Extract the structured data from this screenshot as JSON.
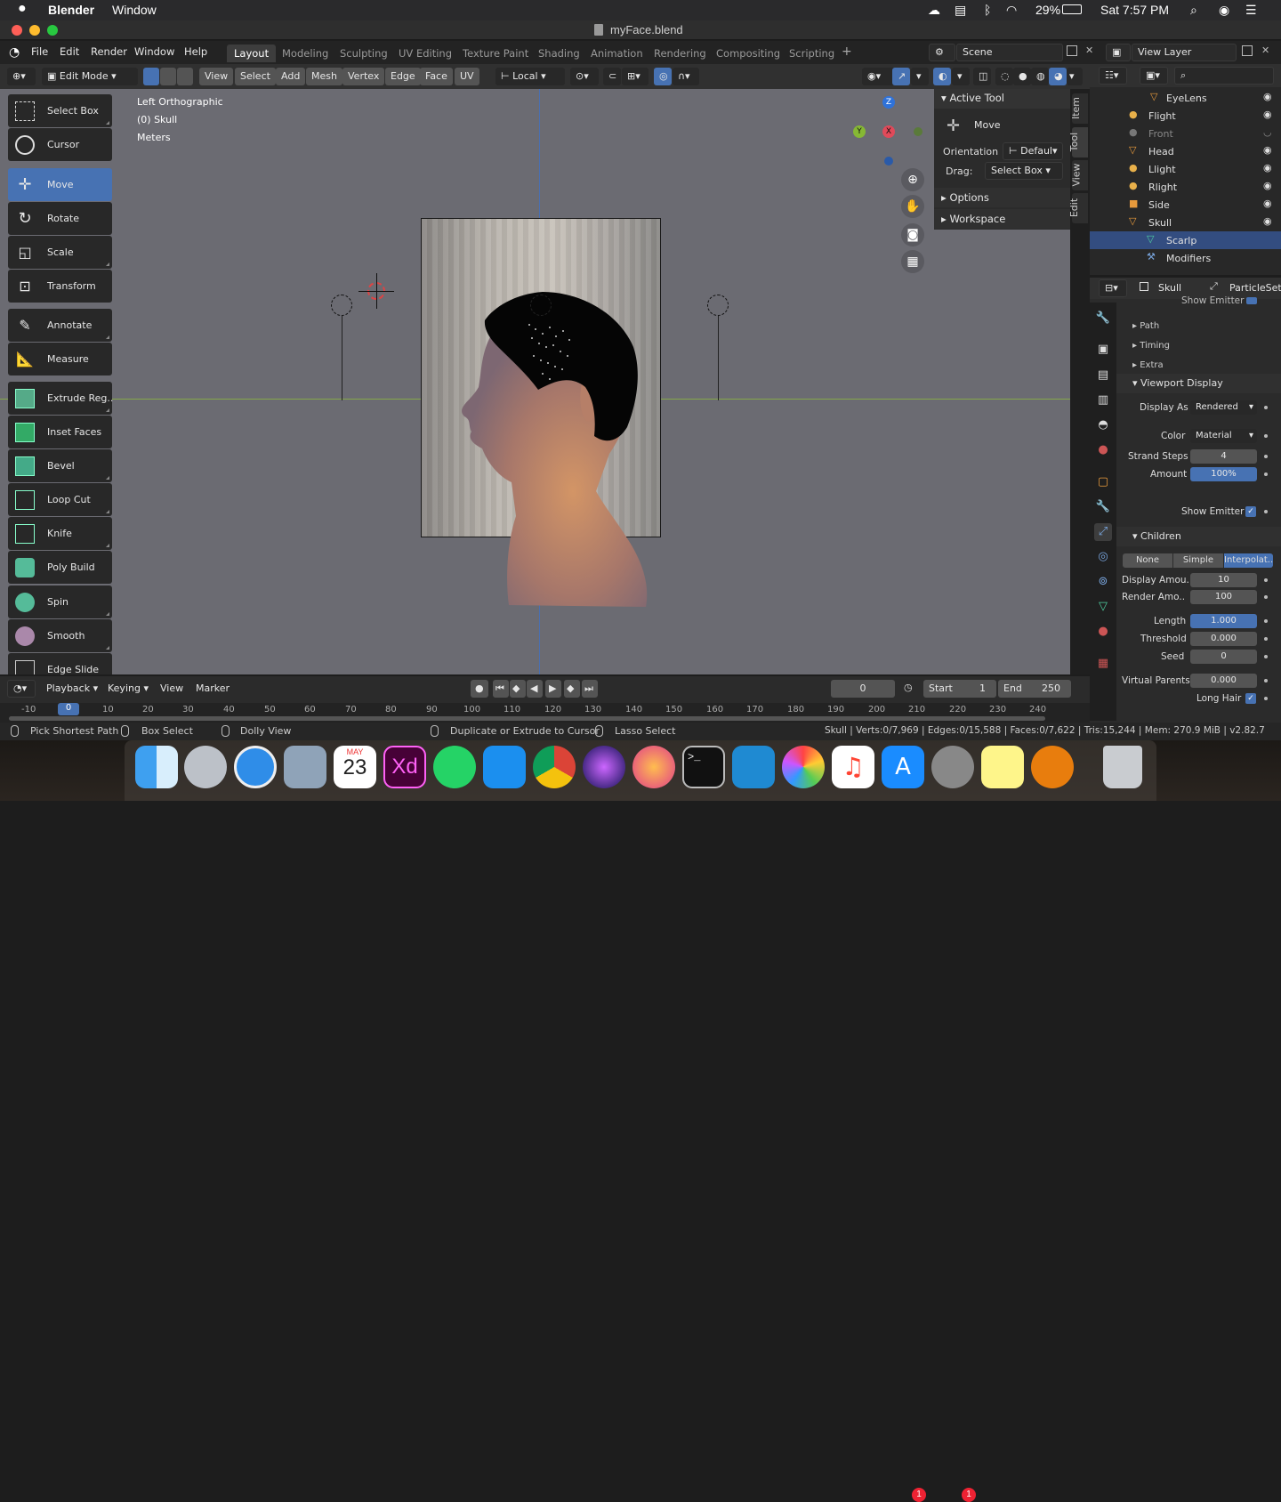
{
  "menubar": {
    "app_name": "Blender",
    "menu_window": "Window",
    "battery": "29%",
    "clock": "Sat 7:57 PM"
  },
  "title": "myFace.blend",
  "topbar": {
    "menus": [
      "File",
      "Edit",
      "Render",
      "Window",
      "Help"
    ],
    "workspaces": [
      "Layout",
      "Modeling",
      "Sculpting",
      "UV Editing",
      "Texture Paint",
      "Shading",
      "Animation",
      "Rendering",
      "Compositing",
      "Scripting"
    ],
    "active_workspace": "Layout",
    "scene": "Scene",
    "view_layer": "View Layer"
  },
  "header": {
    "mode": "Edit Mode",
    "menus": [
      "View",
      "Select",
      "Add",
      "Mesh",
      "Vertex",
      "Edge",
      "Face",
      "UV"
    ],
    "orientation": "Local"
  },
  "viewport": {
    "view_name": "Left Orthographic",
    "object_info": "(0) Skull",
    "units": "Meters",
    "gizmo": {
      "z": "Z",
      "y": "Y",
      "x": "X"
    }
  },
  "toolbar": {
    "tools": [
      {
        "label": "Select Box",
        "icon": "select-box-icon"
      },
      {
        "label": "Cursor",
        "icon": "cursor-icon"
      },
      {
        "label": "Move",
        "icon": "move-icon",
        "active": true
      },
      {
        "label": "Rotate",
        "icon": "rotate-icon"
      },
      {
        "label": "Scale",
        "icon": "scale-icon"
      },
      {
        "label": "Transform",
        "icon": "transform-icon"
      },
      {
        "label": "Annotate",
        "icon": "annotate-icon"
      },
      {
        "label": "Measure",
        "icon": "measure-icon"
      },
      {
        "label": "Extrude Reg..",
        "icon": "extrude-icon"
      },
      {
        "label": "Inset Faces",
        "icon": "inset-icon"
      },
      {
        "label": "Bevel",
        "icon": "bevel-icon"
      },
      {
        "label": "Loop Cut",
        "icon": "loop-cut-icon"
      },
      {
        "label": "Knife",
        "icon": "knife-icon"
      },
      {
        "label": "Poly Build",
        "icon": "poly-build-icon"
      },
      {
        "label": "Spin",
        "icon": "spin-icon"
      },
      {
        "label": "Smooth",
        "icon": "smooth-icon"
      },
      {
        "label": "Edge Slide",
        "icon": "edge-slide-icon"
      }
    ]
  },
  "npanel": {
    "active_tool_title": "Active Tool",
    "tool_name": "Move",
    "orientation_label": "Orientation",
    "orientation_value": "Defaul",
    "drag_label": "Drag:",
    "drag_value": "Select Box",
    "options": "Options",
    "workspace": "Workspace",
    "tabs": [
      "Item",
      "Tool",
      "View",
      "Edit"
    ]
  },
  "outliner": {
    "items": [
      {
        "name": "EyeLens",
        "icon": "mesh-icon",
        "color": "#e89a3c"
      },
      {
        "name": "Flight",
        "icon": "light-icon",
        "color": "#e8b04a"
      },
      {
        "name": "Front",
        "icon": "camera-icon",
        "color": "#777"
      },
      {
        "name": "Head",
        "icon": "mesh-icon",
        "color": "#e89a3c"
      },
      {
        "name": "Llight",
        "icon": "light-icon",
        "color": "#e8b04a"
      },
      {
        "name": "Rlight",
        "icon": "light-icon",
        "color": "#e8b04a"
      },
      {
        "name": "Side",
        "icon": "camera-icon",
        "color": "#e89a3c"
      },
      {
        "name": "Skull",
        "icon": "mesh-icon",
        "color": "#e89a3c"
      },
      {
        "name": "Scarlp",
        "icon": "hair-icon",
        "color": "#4fcfa0"
      },
      {
        "name": "Modifiers",
        "icon": "wrench-icon",
        "color": "#7aa7e0"
      }
    ]
  },
  "properties": {
    "object": "Skull",
    "settings": "ParticleSett",
    "show_emitter_top": "Show Emitter",
    "path": "Path",
    "timing": "Timing",
    "extra": "Extra",
    "viewport_display": "Viewport Display",
    "display_as_label": "Display As",
    "display_as_value": "Rendered",
    "color_label": "Color",
    "color_value": "Material",
    "strand_steps_label": "Strand Steps",
    "strand_steps_value": "4",
    "amount_label": "Amount",
    "amount_value": "100%",
    "show_emitter": "Show Emitter",
    "children": "Children",
    "children_modes": [
      "None",
      "Simple",
      "Interpolat.."
    ],
    "display_amount_label": "Display Amou..",
    "display_amount_value": "10",
    "render_amount_label": "Render Amo..",
    "render_amount_value": "100",
    "length_label": "Length",
    "length_value": "1.000",
    "threshold_label": "Threshold",
    "threshold_value": "0.000",
    "seed_label": "Seed",
    "seed_value": "0",
    "virtual_parents_label": "Virtual Parents",
    "virtual_parents_value": "0.000",
    "long_hair": "Long Hair"
  },
  "timeline": {
    "menus": [
      "Playback",
      "Keying",
      "View",
      "Marker"
    ],
    "current_frame": "0",
    "start_label": "Start",
    "start_value": "1",
    "end_label": "End",
    "end_value": "250",
    "ruler": [
      "-10",
      "0",
      "10",
      "20",
      "30",
      "40",
      "50",
      "60",
      "70",
      "80",
      "90",
      "100",
      "110",
      "120",
      "130",
      "140",
      "150",
      "160",
      "170",
      "180",
      "190",
      "200",
      "210",
      "220",
      "230",
      "240"
    ]
  },
  "status": {
    "pick": "Pick Shortest Path",
    "box": "Box Select",
    "dolly": "Dolly View",
    "duplicate": "Duplicate or Extrude to Cursor",
    "lasso": "Lasso Select",
    "stats": "Skull | Verts:0/7,969 | Edges:0/15,588 | Faces:0/7,622 | Tris:15,244 | Mem: 270.9 MiB | v2.82.7"
  },
  "dock": {
    "calendar_month": "MAY",
    "calendar_day": "23",
    "xd_label": "Xd",
    "badge_appstore": "1",
    "badge_prefs": "1",
    "apps": [
      "finder-icon",
      "launchpad-icon",
      "safari-icon",
      "preview-icon",
      "calendar-icon",
      "xd-icon",
      "whatsapp-icon",
      "xcode-icon",
      "chrome-icon",
      "siri-icon",
      "firefox-icon",
      "terminal-icon",
      "vscode-icon",
      "photos-icon",
      "music-icon",
      "appstore-icon",
      "system-preferences-icon",
      "stickies-icon",
      "blender-icon",
      "trash-icon"
    ]
  }
}
